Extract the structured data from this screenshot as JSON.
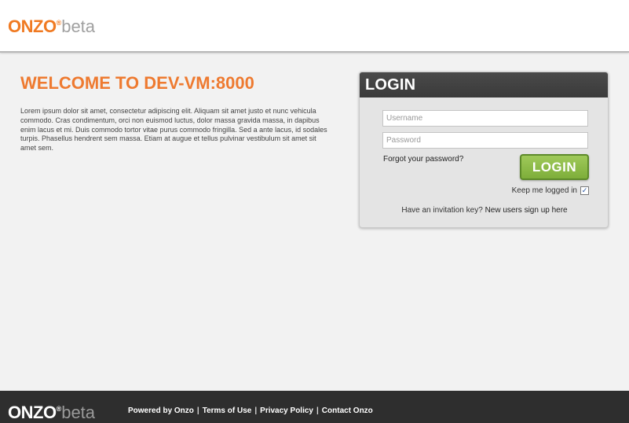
{
  "header": {
    "logo_brand": "ONZO",
    "logo_mark": "®",
    "logo_beta": "beta"
  },
  "welcome": {
    "title": "WELCOME TO DEV-VM:8000",
    "text": "Lorem ipsum dolor sit amet, consectetur adipiscing elit. Aliquam sit amet justo et nunc vehicula commodo. Cras condimentum, orci non euismod luctus, dolor massa gravida massa, in dapibus enim lacus et mi. Duis commodo tortor vitae purus commodo fringilla. Sed a ante lacus, id sodales turpis. Phasellus hendrent sem massa. Etiam at augue et tellus pulvinar vestibulum sit amet sit amet sem."
  },
  "login": {
    "title": "LOGIN",
    "username_placeholder": "Username",
    "password_placeholder": "Password",
    "forgot_label": "Forgot your password?",
    "button_label": "LOGIN",
    "keep_logged_label": "Keep me logged in",
    "keep_logged_checked": true,
    "checkbox_mark": "✓",
    "invite_prompt": "Have an invitation key?",
    "signup_label": "New users sign up here"
  },
  "footer": {
    "logo_brand": "ONZO",
    "logo_mark": "®",
    "logo_beta": "beta",
    "links": [
      "Powered by Onzo",
      "Terms of Use",
      "Privacy Policy",
      "Contact Onzo"
    ],
    "separator": "|"
  },
  "colors": {
    "brand_orange": "#f07a22",
    "login_green": "#8cbb4a",
    "footer_bg": "#2e2e2e"
  }
}
